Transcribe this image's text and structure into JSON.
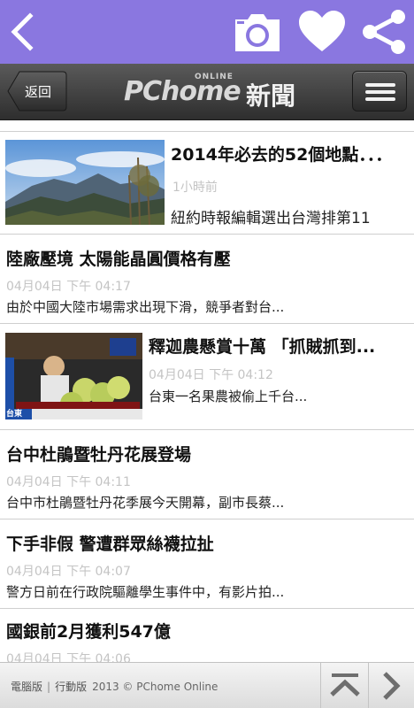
{
  "top_bar": {
    "accent_color": "#8a77e0",
    "icons": [
      "back-arrow-icon",
      "camera-icon",
      "heart-icon",
      "share-icon"
    ]
  },
  "header": {
    "back_label": "返回",
    "logo_text": "PChome",
    "logo_super": "ONLINE",
    "logo_news": "新聞"
  },
  "articles": [
    {
      "title": "2014年必去的52個地點．．．",
      "time": "1小時前",
      "summary": "紐約時報編輯選出台灣排第11",
      "has_image": true,
      "image": "mountain-landscape"
    },
    {
      "title": "陸廠壓境 太陽能晶圓價格有壓",
      "time": "04月04日 下午 04:17",
      "summary": "由於中國大陸市場需求出現下滑，競爭者對台...",
      "has_image": false
    },
    {
      "title": "釋迦農懸賞十萬 「抓賊抓到...",
      "time": "04月04日 下午 04:12",
      "summary": "台東一名果農被偷上千台...",
      "has_image": true,
      "image": "custard-apple-farmer",
      "image_caption": "台東"
    },
    {
      "title": "台中杜鵑暨牡丹花展登場",
      "time": "04月04日 下午 04:11",
      "summary": "台中市杜鵑暨牡丹花季展今天開幕，副市長蔡...",
      "has_image": false
    },
    {
      "title": "下手非假 警遭群眾絲襪拉扯",
      "time": "04月04日 下午 04:07",
      "summary": "警方日前在行政院驅離學生事件中，有影片拍...",
      "has_image": false
    },
    {
      "title": "國銀前2月獲利547億",
      "time": "04月04日 下午 04:06",
      "summary": "",
      "has_image": false
    }
  ],
  "footer": {
    "desktop_label": "電腦版",
    "mobile_label": "行動版",
    "copyright": "2013 © PChome Online",
    "icons": [
      "scroll-top-icon",
      "next-arrow-icon"
    ]
  }
}
